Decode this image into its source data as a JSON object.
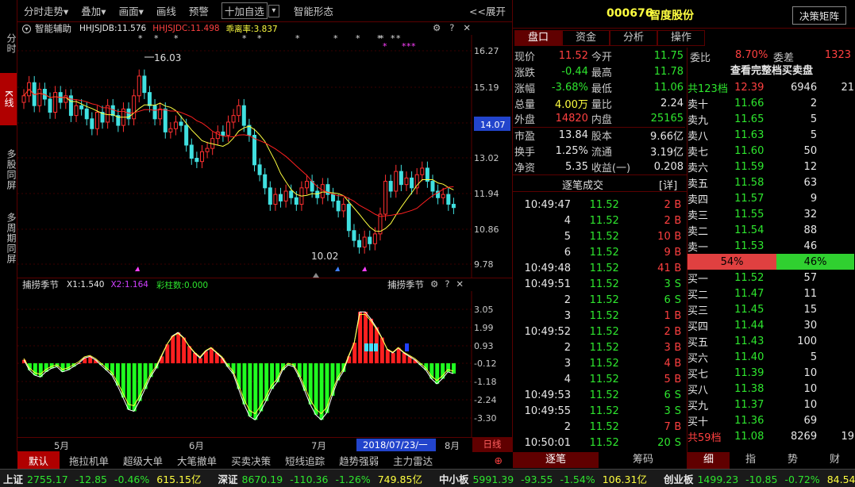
{
  "left_sidebar": [
    "分时",
    "K线",
    "多股同屏",
    "多周期同屏"
  ],
  "toolbar": {
    "items": [
      "分时走势▾",
      "叠加▾",
      "画面▾",
      "画线",
      "预警"
    ],
    "watch": "十加自选",
    "dropdown": "▾",
    "pattern": "智能形态",
    "expand": "<<展开"
  },
  "main_chart": {
    "indicator_name": "智能辅助",
    "v1_label": "HHJSJDB:11.576",
    "v2_label": "HHJSJDC:11.498",
    "v3_label": "乖离率:3.837",
    "icons": "⚙ ? ✕",
    "y_ticks": [
      "16.27",
      "15.19",
      "14.07",
      "13.02",
      "11.94",
      "10.86",
      "9.78"
    ],
    "current_price": "14.07",
    "high_label": "16.03",
    "low_label": "10.02"
  },
  "sub_chart": {
    "indicator_name": "捕捞季节",
    "x1": "X1:1.540",
    "x2": "X2:1.164",
    "bars": "彩柱数:0.000",
    "right_name": "捕捞季节",
    "y_ticks": [
      "3.05",
      "1.99",
      "0.93",
      "-0.12",
      "-1.18",
      "-2.24",
      "-3.30"
    ]
  },
  "x_axis": {
    "months": [
      "5月",
      "6月",
      "7月",
      "8月"
    ],
    "cursor_date": "2018/07/23/一",
    "period": "日线"
  },
  "bottom_tabs": [
    "默认",
    "拖拉机单",
    "超级大单",
    "大笔撤单",
    "买卖决策",
    "短线追踪",
    "趋势强弱",
    "主力雷达"
  ],
  "bottom_arrow": "⊕",
  "stock": {
    "code": "000676",
    "name": "智度股份",
    "button": "决策矩阵"
  },
  "right_tabs": [
    "盘口",
    "资金",
    "分析",
    "操作"
  ],
  "quote": [
    [
      "现价",
      "11.52",
      "今开",
      "11.75"
    ],
    [
      "涨跌",
      "-0.44",
      "最高",
      "11.78"
    ],
    [
      "涨幅",
      "-3.68%",
      "最低",
      "11.06"
    ],
    [
      "总量",
      "4.00万",
      "量比",
      "2.24"
    ],
    [
      "外盘",
      "14820",
      "内盘",
      "25165"
    ],
    [
      "市盈",
      "13.84",
      "股本",
      "9.66亿"
    ],
    [
      "换手",
      "1.25%",
      "流通",
      "3.19亿"
    ],
    [
      "净资",
      "5.35",
      "收益(一)",
      "0.208"
    ]
  ],
  "trades_header": {
    "title": "逐笔成交",
    "detail": "[详]"
  },
  "trades": [
    [
      "10:49:47",
      "11.52",
      "2",
      "B"
    ],
    [
      "4",
      "11.52",
      "2",
      "B"
    ],
    [
      "5",
      "11.52",
      "10",
      "B"
    ],
    [
      "6",
      "11.52",
      "9",
      "B"
    ],
    [
      "10:49:48",
      "11.52",
      "41",
      "B"
    ],
    [
      "10:49:51",
      "11.52",
      "3",
      "S"
    ],
    [
      "2",
      "11.52",
      "6",
      "S"
    ],
    [
      "3",
      "11.52",
      "1",
      "B"
    ],
    [
      "10:49:52",
      "11.52",
      "2",
      "B"
    ],
    [
      "2",
      "11.52",
      "3",
      "B"
    ],
    [
      "3",
      "11.52",
      "4",
      "B"
    ],
    [
      "4",
      "11.52",
      "5",
      "B"
    ],
    [
      "10:49:53",
      "11.52",
      "6",
      "S"
    ],
    [
      "10:49:55",
      "11.52",
      "3",
      "S"
    ],
    [
      "2",
      "11.52",
      "7",
      "B"
    ],
    [
      "10:50:01",
      "11.52",
      "20",
      "S"
    ]
  ],
  "trades_tabs": [
    "逐笔",
    "筹码"
  ],
  "orderbook": {
    "wei_bi_label": "委比",
    "wei_bi": "8.70%",
    "wei_cha_label": "委差",
    "wei_cha": "1323",
    "full_link": "查看完整档买卖盘",
    "sell_total": [
      "共123档",
      "12.39",
      "6946",
      "21"
    ],
    "asks": [
      [
        "卖十",
        "11.66",
        "2"
      ],
      [
        "卖九",
        "11.65",
        "5"
      ],
      [
        "卖八",
        "11.63",
        "5"
      ],
      [
        "卖七",
        "11.60",
        "50"
      ],
      [
        "卖六",
        "11.59",
        "12"
      ],
      [
        "卖五",
        "11.58",
        "63"
      ],
      [
        "卖四",
        "11.57",
        "9"
      ],
      [
        "卖三",
        "11.55",
        "32"
      ],
      [
        "卖二",
        "11.54",
        "88"
      ],
      [
        "卖一",
        "11.53",
        "46"
      ]
    ],
    "ratio": [
      "54%",
      "46%"
    ],
    "bids": [
      [
        "买一",
        "11.52",
        "57"
      ],
      [
        "买二",
        "11.47",
        "11"
      ],
      [
        "买三",
        "11.45",
        "15"
      ],
      [
        "买四",
        "11.44",
        "30"
      ],
      [
        "买五",
        "11.43",
        "100"
      ],
      [
        "买六",
        "11.40",
        "5"
      ],
      [
        "买七",
        "11.39",
        "10"
      ],
      [
        "买八",
        "11.38",
        "10"
      ],
      [
        "买九",
        "11.37",
        "10"
      ],
      [
        "买十",
        "11.36",
        "69"
      ]
    ],
    "buy_total": [
      "共59档",
      "11.08",
      "8269",
      "19"
    ],
    "tabs": [
      "细",
      "指",
      "势",
      "财"
    ]
  },
  "status_bar": [
    [
      "上证",
      "2755.17",
      "-12.85",
      "-0.46%",
      "615.15亿"
    ],
    [
      "深证",
      "8670.19",
      "-110.36",
      "-1.26%",
      "749.85亿"
    ],
    [
      "中小板",
      "5991.39",
      "-93.55",
      "-1.54%",
      "106.31亿"
    ],
    [
      "创业板",
      "1499.23",
      "-10.85",
      "-0.72%",
      "84.54亿"
    ]
  ]
}
